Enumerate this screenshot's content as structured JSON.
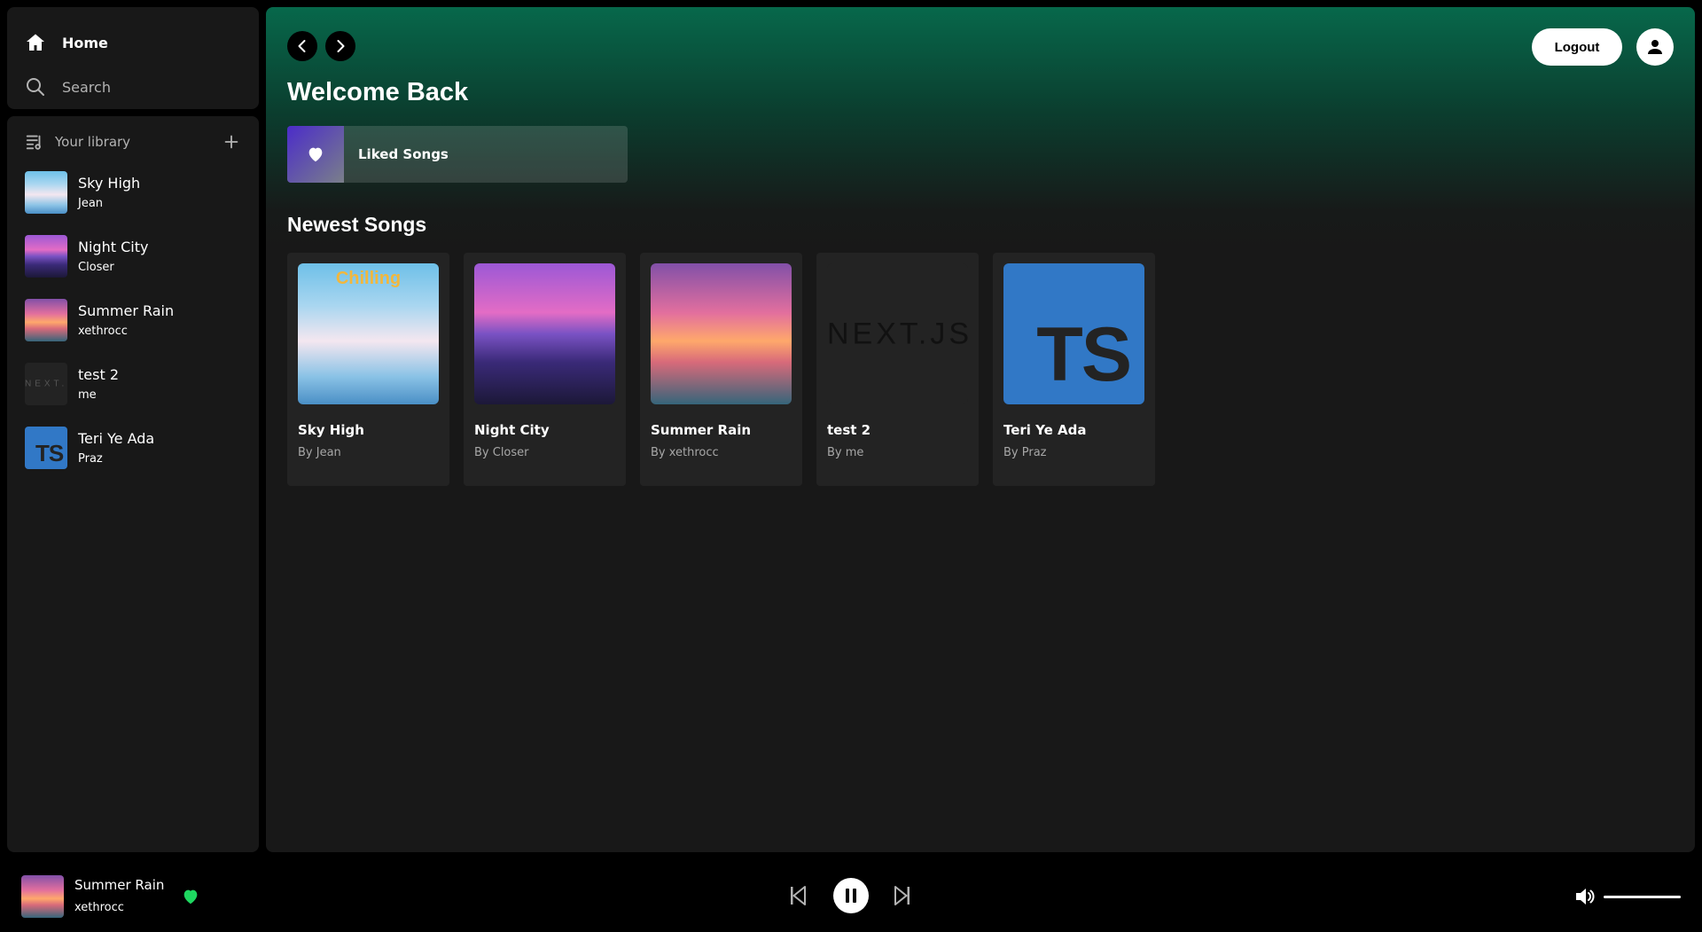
{
  "nav": {
    "home_label": "Home",
    "search_label": "Search"
  },
  "library": {
    "title": "Your library",
    "items": [
      {
        "title": "Sky High",
        "artist": "Jean",
        "art": "sky"
      },
      {
        "title": "Night City",
        "artist": "Closer",
        "art": "night"
      },
      {
        "title": "Summer Rain",
        "artist": "xethrocc",
        "art": "summer"
      },
      {
        "title": "test 2",
        "artist": "me",
        "art": "next"
      },
      {
        "title": "Teri Ye Ada",
        "artist": "Praz",
        "art": "ts"
      }
    ]
  },
  "header": {
    "logout_label": "Logout",
    "welcome": "Welcome Back",
    "liked_songs_label": "Liked Songs"
  },
  "newest": {
    "title": "Newest Songs",
    "songs": [
      {
        "title": "Sky High",
        "byline": "By Jean",
        "art": "sky",
        "art_text": "Chilling"
      },
      {
        "title": "Night City",
        "byline": "By Closer",
        "art": "night"
      },
      {
        "title": "Summer Rain",
        "byline": "By xethrocc",
        "art": "summer"
      },
      {
        "title": "test 2",
        "byline": "By me",
        "art": "next",
        "art_text": "NEXT.JS"
      },
      {
        "title": "Teri Ye Ada",
        "byline": "By Praz",
        "art": "ts",
        "art_text": "TS"
      }
    ]
  },
  "player": {
    "title": "Summer Rain",
    "artist": "xethrocc",
    "liked": true,
    "is_playing": true,
    "volume": 1.0
  },
  "colors": {
    "accent_green": "#1ed760",
    "header_gradient": "#07684b"
  }
}
